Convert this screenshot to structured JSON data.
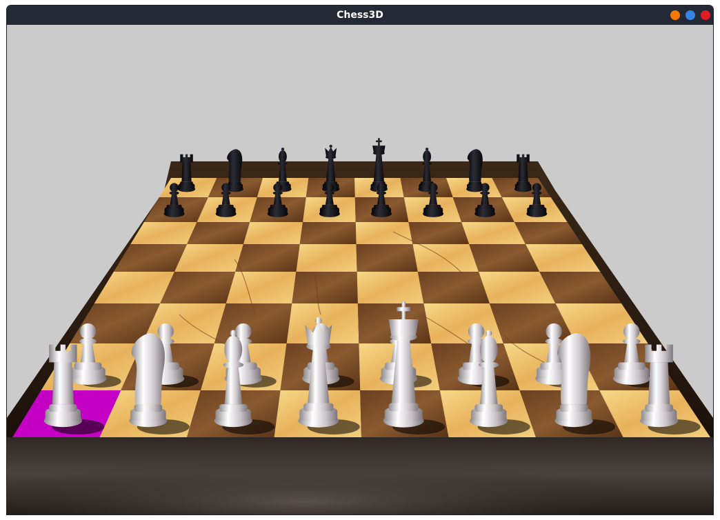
{
  "window": {
    "title": "Chess3D",
    "controls": [
      {
        "name": "minimize-button",
        "color": "#f57900"
      },
      {
        "name": "maximize-button",
        "color": "#3584e4"
      },
      {
        "name": "close-button",
        "color": "#e01b24"
      }
    ]
  },
  "scene": {
    "background_color": "#cbcbcb",
    "selected_square": "a1",
    "highlight_color": "#c400c4",
    "black_back_rank": [
      "rook",
      "knight",
      "bishop",
      "queen",
      "king",
      "bishop",
      "knight",
      "rook"
    ],
    "white_back_rank": [
      "rook",
      "knight",
      "bishop",
      "queen",
      "king",
      "bishop",
      "knight",
      "rook"
    ],
    "pawns_per_side": 8
  }
}
